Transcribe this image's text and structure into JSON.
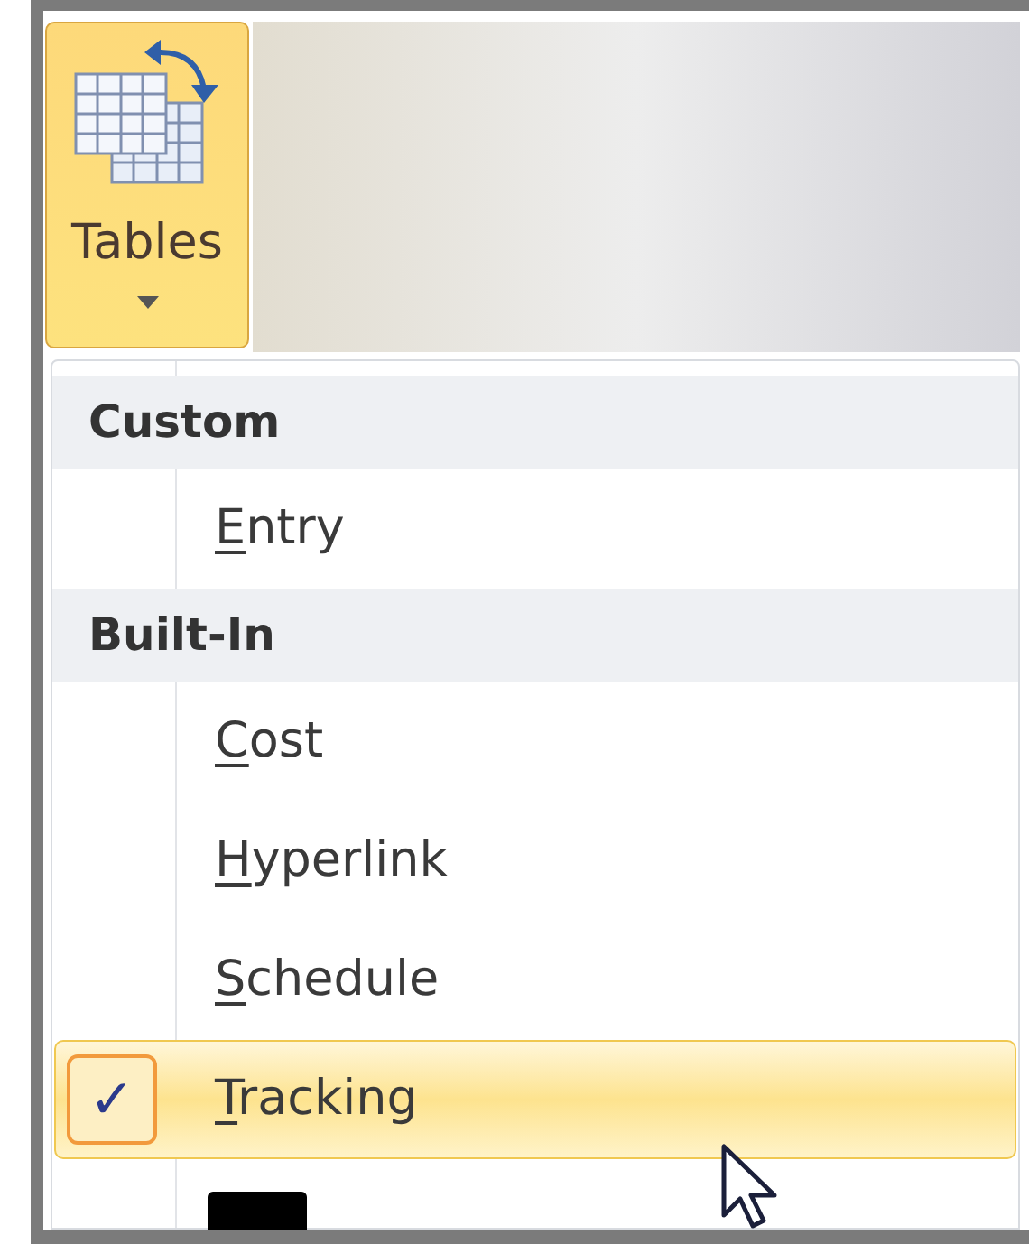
{
  "ribbon_button": {
    "label": "Tables"
  },
  "menu": [
    {
      "kind": "header",
      "label": "Custom"
    },
    {
      "kind": "item",
      "label": "Entry",
      "checked": false
    },
    {
      "kind": "header",
      "label": "Built-In"
    },
    {
      "kind": "item",
      "label": "Cost",
      "checked": false
    },
    {
      "kind": "item",
      "label": "Hyperlink",
      "checked": false
    },
    {
      "kind": "item",
      "label": "Schedule",
      "checked": false
    },
    {
      "kind": "item",
      "label": "Tracking",
      "checked": true,
      "check_mark": "✓"
    }
  ]
}
